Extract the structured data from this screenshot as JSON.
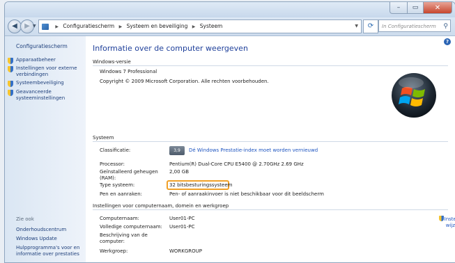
{
  "window": {
    "controls": {
      "minimize": "–",
      "maximize": "▭",
      "close": "✕"
    }
  },
  "address_bar": {
    "breadcrumbs": [
      "Configuratiescherm",
      "Systeem en beveiliging",
      "Systeem"
    ],
    "search_placeholder": "In Configuratiescherm zoeken"
  },
  "sidebar": {
    "home": "Configuratiescherm",
    "tasks": [
      "Apparaatbeheer",
      "Instellingen voor externe verbindingen",
      "Systeembeveiliging",
      "Geavanceerde systeeminstellingen"
    ],
    "see_also": "Zie ook",
    "see_also_links": [
      "Onderhoudscentrum",
      "Windows Update",
      "Hulpprogramma's voor en informatie over prestaties"
    ]
  },
  "main": {
    "title": "Informatie over de computer weergeven",
    "edition": {
      "heading": "Windows-versie",
      "name": "Windows 7 Professional",
      "copyright": "Copyright © 2009 Microsoft Corporation. Alle rechten voorbehouden."
    },
    "system": {
      "heading": "Systeem",
      "rows": [
        {
          "label": "Classificatie:",
          "value": "Dé Windows Prestatie-index moet worden vernieuwd"
        },
        {
          "label": "Processor:",
          "value": "Pentium(R) Dual-Core CPU    E5400 @ 2.70GHz   2.69 GHz"
        },
        {
          "label": "Geïnstalleerd geheugen (RAM):",
          "value": "2,00 GB"
        },
        {
          "label": "Type systeem:",
          "value": "32 bitsbesturingssysteem"
        },
        {
          "label": "Pen en aanraken:",
          "value": "Pen- of aanraakinvoer is niet beschikbaar voor dit beeldscherm"
        }
      ],
      "rating_badge": "3,9"
    },
    "computer": {
      "heading": "Instellingen voor computernaam, domein en werkgroep",
      "rows": [
        {
          "label": "Computernaam:",
          "value": "User01-PC"
        },
        {
          "label": "Volledige computernaam:",
          "value": "User01-PC"
        },
        {
          "label": "Beschrijving van de computer:",
          "value": ""
        },
        {
          "label": "Werkgroep:",
          "value": "WORKGROUP"
        }
      ],
      "change_settings": "Instellingen wijzigen"
    },
    "help_icon": "?"
  },
  "colors": {
    "highlight": "#f0a028",
    "link": "#1e55c0",
    "title": "#1e3f9a"
  }
}
